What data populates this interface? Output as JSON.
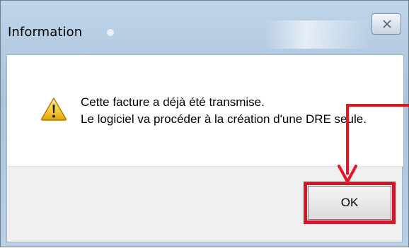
{
  "dialog": {
    "title": "Information",
    "close_icon": "close-icon",
    "icon": "warning-icon",
    "message_lines": [
      "Cette facture a déjà été transmise.",
      "Le logiciel va procéder à la création d'une DRE seule."
    ],
    "ok_label": "OK"
  },
  "annotation": {
    "arrow_color": "#e8141f",
    "highlight_color": "#d3172b"
  }
}
